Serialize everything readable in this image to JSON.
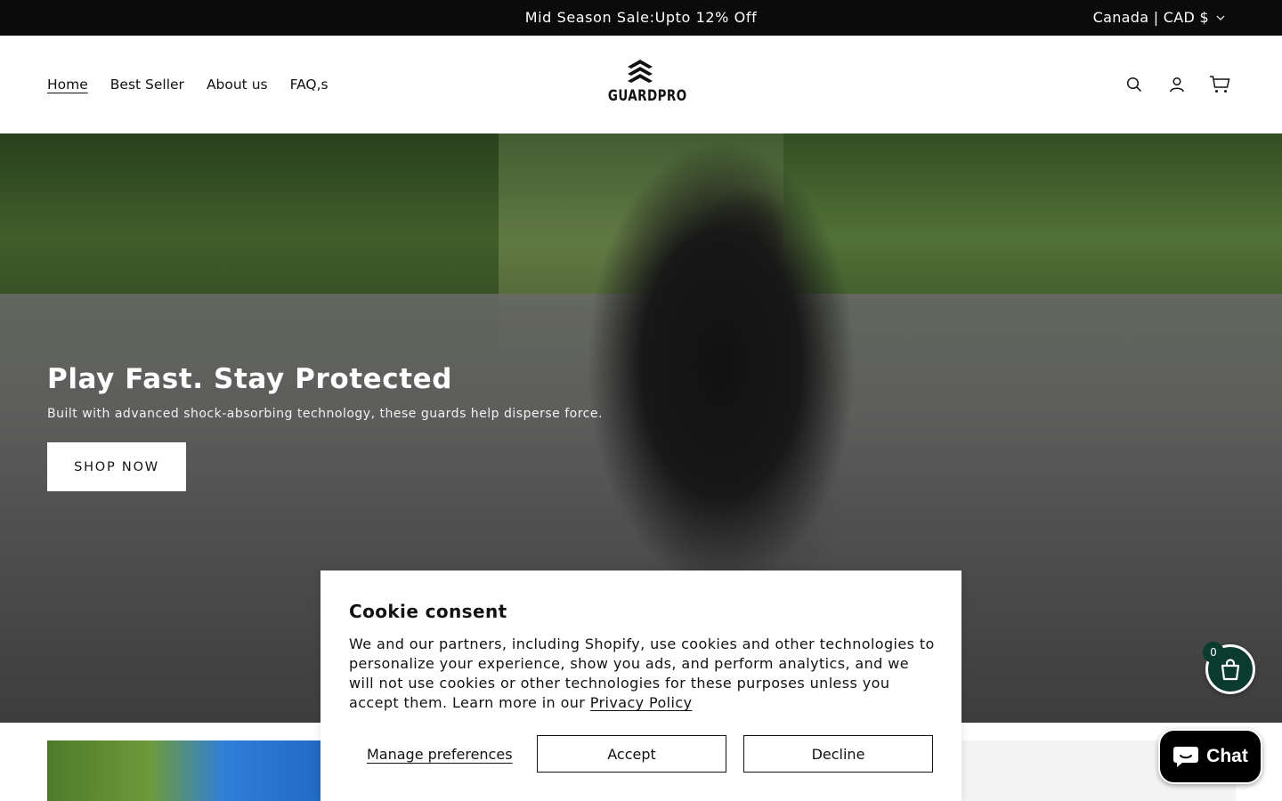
{
  "announcement": {
    "message": "Mid Season Sale:Upto 12% Off",
    "locale": "Canada | CAD $",
    "chevron_icon": "chevron-down-icon"
  },
  "nav": {
    "items": [
      {
        "label": "Home",
        "active": true
      },
      {
        "label": "Best Seller"
      },
      {
        "label": "About us"
      },
      {
        "label": "FAQ,s"
      }
    ]
  },
  "brand": {
    "name": "GUARDPRO"
  },
  "header_icons": [
    "search-icon",
    "account-icon",
    "cart-icon"
  ],
  "hero": {
    "title": "Play Fast. Stay Protected",
    "subtitle": "Built with advanced shock-absorbing technology, these guards help disperse force.",
    "button_label": "SHOP NOW"
  },
  "cookie": {
    "title": "Cookie consent",
    "body": "We and our partners, including Shopify, use cookies and other technologies to personalize your experience, show you ads, and perform analytics, and we will not use cookies or other technologies for these purposes unless you accept them. Learn more in our",
    "policy_link": "Privacy Policy",
    "manage_label": "Manage preferences",
    "accept_label": "Accept",
    "decline_label": "Decline"
  },
  "floating_cart": {
    "count": "0"
  },
  "chat": {
    "label": "Chat"
  },
  "colors": {
    "announcement_bg": "#0b0b0b",
    "cart_bubble": "#0b3a2e",
    "chat_bg": "#000000"
  }
}
